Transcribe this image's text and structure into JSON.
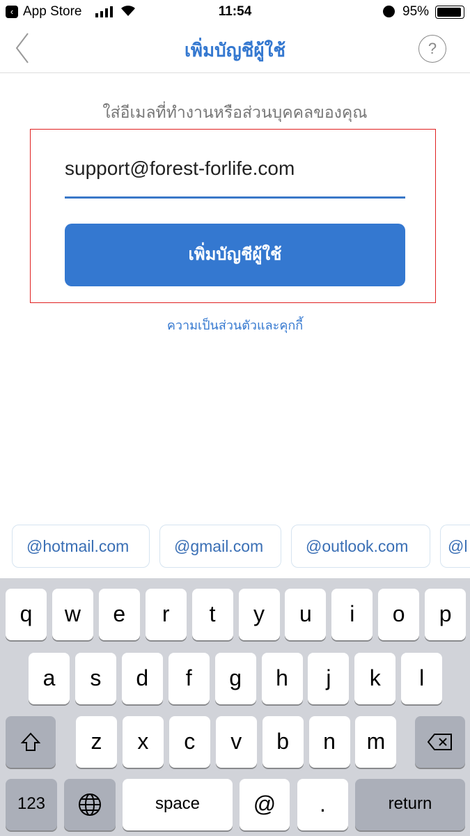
{
  "status_bar": {
    "back_app": "App Store",
    "time": "11:54",
    "battery": "95%"
  },
  "nav": {
    "title": "เพิ่มบัญชีผู้ใช้",
    "help": "?"
  },
  "form": {
    "prompt": "ใส่อีเมลที่ทำงานหรือส่วนบุคคลของคุณ",
    "email_value": "support@forest-forlife.com",
    "add_button": "เพิ่มบัญชีผู้ใช้",
    "privacy_link": "ความเป็นส่วนตัวและคุกกี้"
  },
  "suggestions": [
    "@hotmail.com",
    "@gmail.com",
    "@outlook.com",
    "@l"
  ],
  "keyboard": {
    "row1": [
      "q",
      "w",
      "e",
      "r",
      "t",
      "y",
      "u",
      "i",
      "o",
      "p"
    ],
    "row2": [
      "a",
      "s",
      "d",
      "f",
      "g",
      "h",
      "j",
      "k",
      "l"
    ],
    "row3": [
      "z",
      "x",
      "c",
      "v",
      "b",
      "n",
      "m"
    ],
    "numbers": "123",
    "space": "space",
    "at": "@",
    "dot": ".",
    "return": "return"
  },
  "colors": {
    "accent": "#3478d0",
    "highlight_box": "#e02020"
  }
}
